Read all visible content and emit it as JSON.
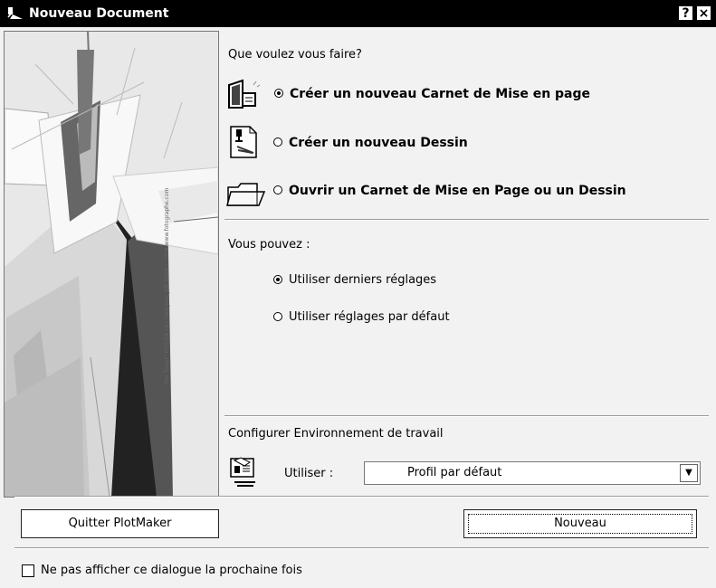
{
  "window": {
    "title": "Nouveau Document",
    "help_button": "?",
    "close_button": "×"
  },
  "art": {
    "caption": "Fire Tower\" KPO DA I by Designer Jett Bailie ... USA www.fotographe.com"
  },
  "main": {
    "prompt": "Que voulez vous faire?",
    "options": [
      {
        "label": "Créer un nouveau Carnet de Mise en page",
        "selected": true
      },
      {
        "label": "Créer un nouveau Dessin",
        "selected": false
      },
      {
        "label": "Ouvrir un Carnet de Mise en Page ou un Dessin",
        "selected": false
      }
    ]
  },
  "settings": {
    "heading": "Vous pouvez :",
    "options": [
      {
        "label": "Utiliser derniers réglages",
        "selected": true
      },
      {
        "label": "Utiliser réglages par défaut",
        "selected": false
      }
    ]
  },
  "environment": {
    "heading": "Configurer Environnement de travail",
    "use_label": "Utiliser :",
    "profile": "Profil par défaut"
  },
  "buttons": {
    "quit": "Quitter PlotMaker",
    "new": "Nouveau"
  },
  "footer": {
    "checkbox_label": "Ne pas afficher ce dialogue la prochaine fois",
    "checked": false
  },
  "icons": [
    "app-icon",
    "layout-book-icon",
    "drawing-icon",
    "folder-open-icon",
    "profile-computer-icon",
    "chevron-down-icon"
  ]
}
